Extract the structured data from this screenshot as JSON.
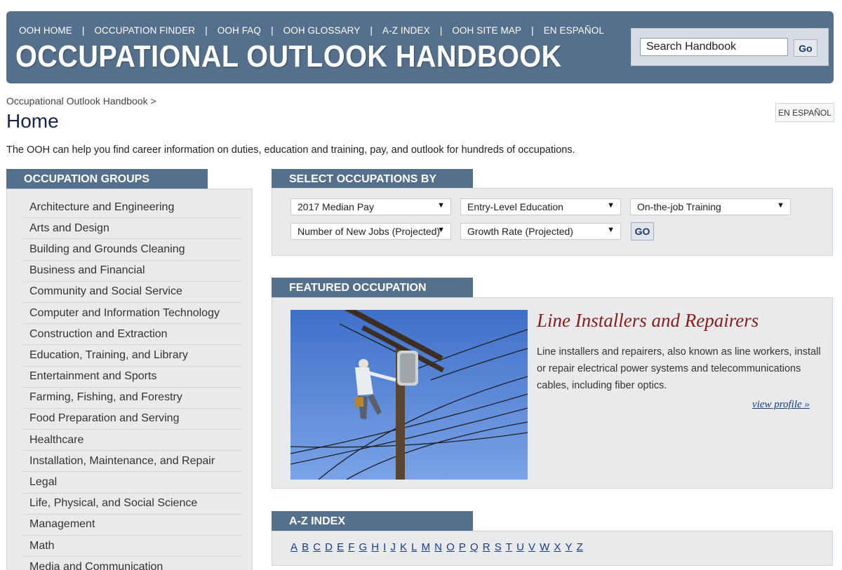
{
  "header": {
    "nav": [
      "OOH HOME",
      "OCCUPATION FINDER",
      "OOH FAQ",
      "OOH GLOSSARY",
      "A-Z INDEX",
      "OOH SITE MAP",
      "EN ESPAÑOL"
    ],
    "logo_text": "OCCUPATIONAL OUTLOOK HANDBOOK",
    "search": {
      "value": "Search Handbook",
      "button": "Go"
    }
  },
  "breadcrumb": {
    "link": "Occupational Outlook Handbook",
    "separator": ">"
  },
  "page_title": "Home",
  "espanol_button": "EN ESPAÑOL",
  "intro": "The OOH can help you find career information on duties, education and training, pay, and outlook for hundreds of occupations.",
  "groups": {
    "title": "OCCUPATION GROUPS",
    "items": [
      "Architecture and Engineering",
      "Arts and Design",
      "Building and Grounds Cleaning",
      "Business and Financial",
      "Community and Social Service",
      "Computer and Information Technology",
      "Construction and Extraction",
      "Education, Training, and Library",
      "Entertainment and Sports",
      "Farming, Fishing, and Forestry",
      "Food Preparation and Serving",
      "Healthcare",
      "Installation, Maintenance, and Repair",
      "Legal",
      "Life, Physical, and Social Science",
      "Management",
      "Math",
      "Media and Communication"
    ]
  },
  "select": {
    "title": "SELECT OCCUPATIONS BY",
    "dropdowns": [
      "2017 Median Pay",
      "Entry-Level Education",
      "On-the-job Training",
      "Number of New Jobs (Projected)",
      "Growth Rate (Projected)"
    ],
    "go": "GO"
  },
  "featured": {
    "title": "FEATURED OCCUPATION",
    "occupation": "Line Installers and Repairers",
    "description": "Line installers and repairers, also known as line workers, install or repair electrical power systems and telecommunications cables, including fiber optics.",
    "link": "view profile »"
  },
  "az": {
    "title": "A-Z INDEX",
    "letters": [
      "A",
      "B",
      "C",
      "D",
      "E",
      "F",
      "G",
      "H",
      "I",
      "J",
      "K",
      "L",
      "M",
      "N",
      "O",
      "P",
      "Q",
      "R",
      "S",
      "T",
      "U",
      "V",
      "W",
      "X",
      "Y",
      "Z"
    ]
  },
  "colors": {
    "header_bg": "#54708c",
    "panel_bg": "#e8eaec",
    "title_red": "#8b1a1a",
    "link_blue": "#1a3a8a"
  }
}
